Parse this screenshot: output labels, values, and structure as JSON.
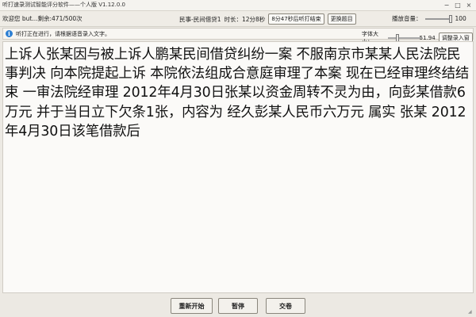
{
  "window": {
    "title": "听打速录测试智能评分软件——个人版 V1.12.0.0",
    "controls": {
      "minimize": "−",
      "maximize": "□",
      "close": "×"
    }
  },
  "toolbar": {
    "greeting": "欢迎您",
    "user": "but...",
    "remaining": "剩余:471/500次",
    "category": "民事-民间借贷1",
    "duration_label": "时长：",
    "duration": "12分8秒",
    "finish_button": "8分47秒后听打结束",
    "change_button": "更换题目",
    "volume_label": "播放音量：",
    "volume_value": "100"
  },
  "infobar": {
    "message": "听打正在进行，请根据语音录入文字。",
    "font_label": "字体大小：",
    "font_value": "51.94",
    "adjust_button": "调整录入窗口"
  },
  "editor": {
    "content": "上诉人张某因与被上诉人鹏某民间借贷纠纷一案 不服南京市某某人民法院民事判决 向本院提起上诉 本院依法组成合意庭审理了本案 现在已经审理终结结束 一审法院经审理 2012年4月30日张某以资金周转不灵为由，向彭某借款6万元 并于当日立下欠条1张，内容为 经久彭某人民币六万元 属实 张某 2012年4月30日该笔借款后"
  },
  "bottom": {
    "restart": "重新开始",
    "pause": "暂停",
    "submit": "交卷"
  },
  "colors": {
    "info_icon": "#2d7fd3"
  },
  "volume_level": 1.0,
  "font_size_level": 0.3
}
